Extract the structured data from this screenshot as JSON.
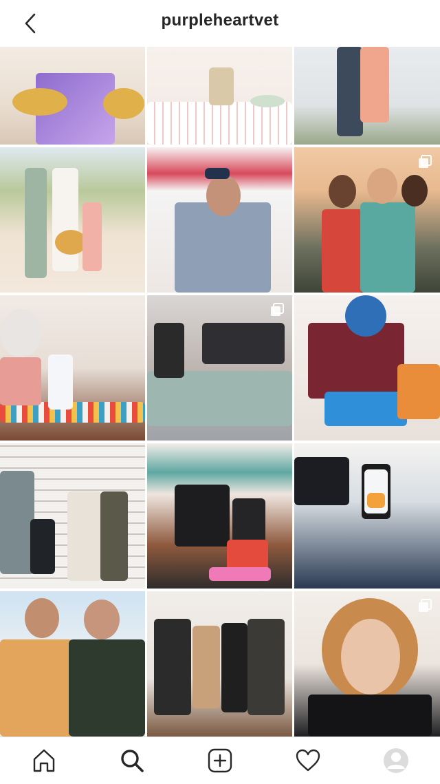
{
  "header": {
    "username": "purpleheartvet",
    "back_icon": "chevron-left-icon"
  },
  "grid": {
    "posts": [
      {
        "id": "post-1",
        "multi": false
      },
      {
        "id": "post-2",
        "multi": false
      },
      {
        "id": "post-3",
        "multi": false
      },
      {
        "id": "post-4",
        "multi": false
      },
      {
        "id": "post-5",
        "multi": false
      },
      {
        "id": "post-6",
        "multi": true
      },
      {
        "id": "post-7",
        "multi": false
      },
      {
        "id": "post-8",
        "multi": true
      },
      {
        "id": "post-9",
        "multi": false
      },
      {
        "id": "post-10",
        "multi": false
      },
      {
        "id": "post-11",
        "multi": false
      },
      {
        "id": "post-12",
        "multi": false
      },
      {
        "id": "post-13",
        "multi": false
      },
      {
        "id": "post-14",
        "multi": false
      },
      {
        "id": "post-15",
        "multi": true
      }
    ]
  },
  "tabbar": {
    "items": [
      {
        "name": "home",
        "icon": "home-icon"
      },
      {
        "name": "search",
        "icon": "search-icon",
        "active": true
      },
      {
        "name": "new-post",
        "icon": "add-post-icon"
      },
      {
        "name": "activity",
        "icon": "heart-icon"
      },
      {
        "name": "profile",
        "icon": "avatar-icon"
      }
    ]
  },
  "colors": {
    "text": "#262626",
    "divider": "#dbdbdb",
    "background": "#ffffff"
  }
}
